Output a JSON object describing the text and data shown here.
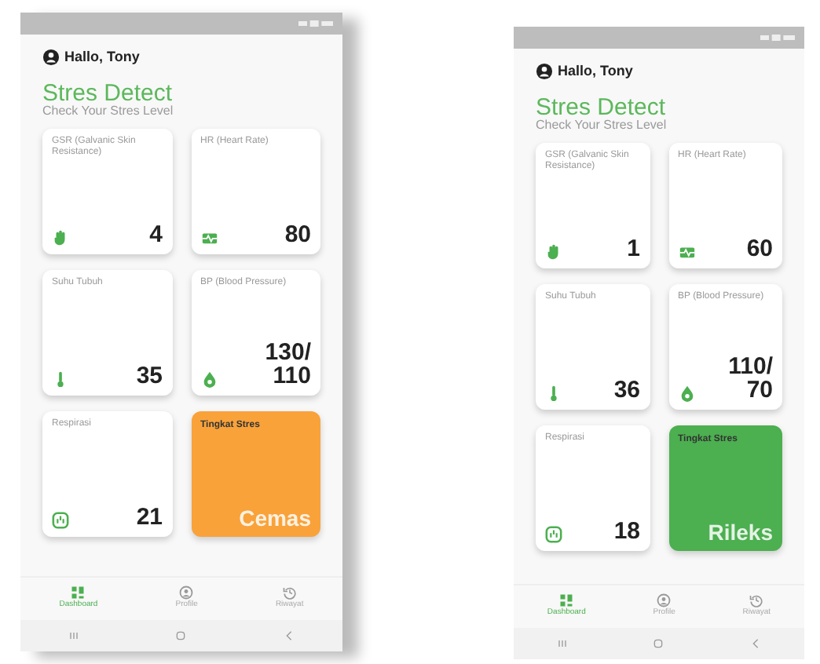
{
  "phones": [
    {
      "greeting": "Hallo, Tony",
      "title": "Stres Detect",
      "subtitle": "Check Your Stres Level",
      "cards": [
        {
          "kind": "metric",
          "label": "GSR (Galvanic Skin Resistance)",
          "value": "4"
        },
        {
          "kind": "metric",
          "label": "HR (Heart Rate)",
          "value": "80"
        },
        {
          "kind": "metric",
          "label": "Suhu Tubuh",
          "value": "35"
        },
        {
          "kind": "metric",
          "label": "BP (Blood Pressure)",
          "value": "130/110"
        },
        {
          "kind": "metric",
          "label": "Respirasi",
          "value": "21"
        },
        {
          "kind": "status",
          "label": "Tingkat Stres",
          "value": "Cemas",
          "color": "#f9a23a"
        }
      ],
      "nav": [
        {
          "label": "Dashboard",
          "selected": true
        },
        {
          "label": "Profile",
          "selected": false
        },
        {
          "label": "Riwayat",
          "selected": false
        }
      ]
    },
    {
      "greeting": "Hallo, Tony",
      "title": "Stres Detect",
      "subtitle": "Check Your Stres Level",
      "cards": [
        {
          "kind": "metric",
          "label": "GSR (Galvanic Skin Resistance)",
          "value": "1"
        },
        {
          "kind": "metric",
          "label": "HR (Heart Rate)",
          "value": "60"
        },
        {
          "kind": "metric",
          "label": "Suhu Tubuh",
          "value": "36"
        },
        {
          "kind": "metric",
          "label": "BP (Blood Pressure)",
          "value": "110/70"
        },
        {
          "kind": "metric",
          "label": "Respirasi",
          "value": "18"
        },
        {
          "kind": "status",
          "label": "Tingkat Stres",
          "value": "Rileks",
          "color": "#4caf50"
        }
      ],
      "nav": [
        {
          "label": "Dashboard",
          "selected": true
        },
        {
          "label": "Profile",
          "selected": false
        },
        {
          "label": "Riwayat",
          "selected": false
        }
      ]
    }
  ]
}
